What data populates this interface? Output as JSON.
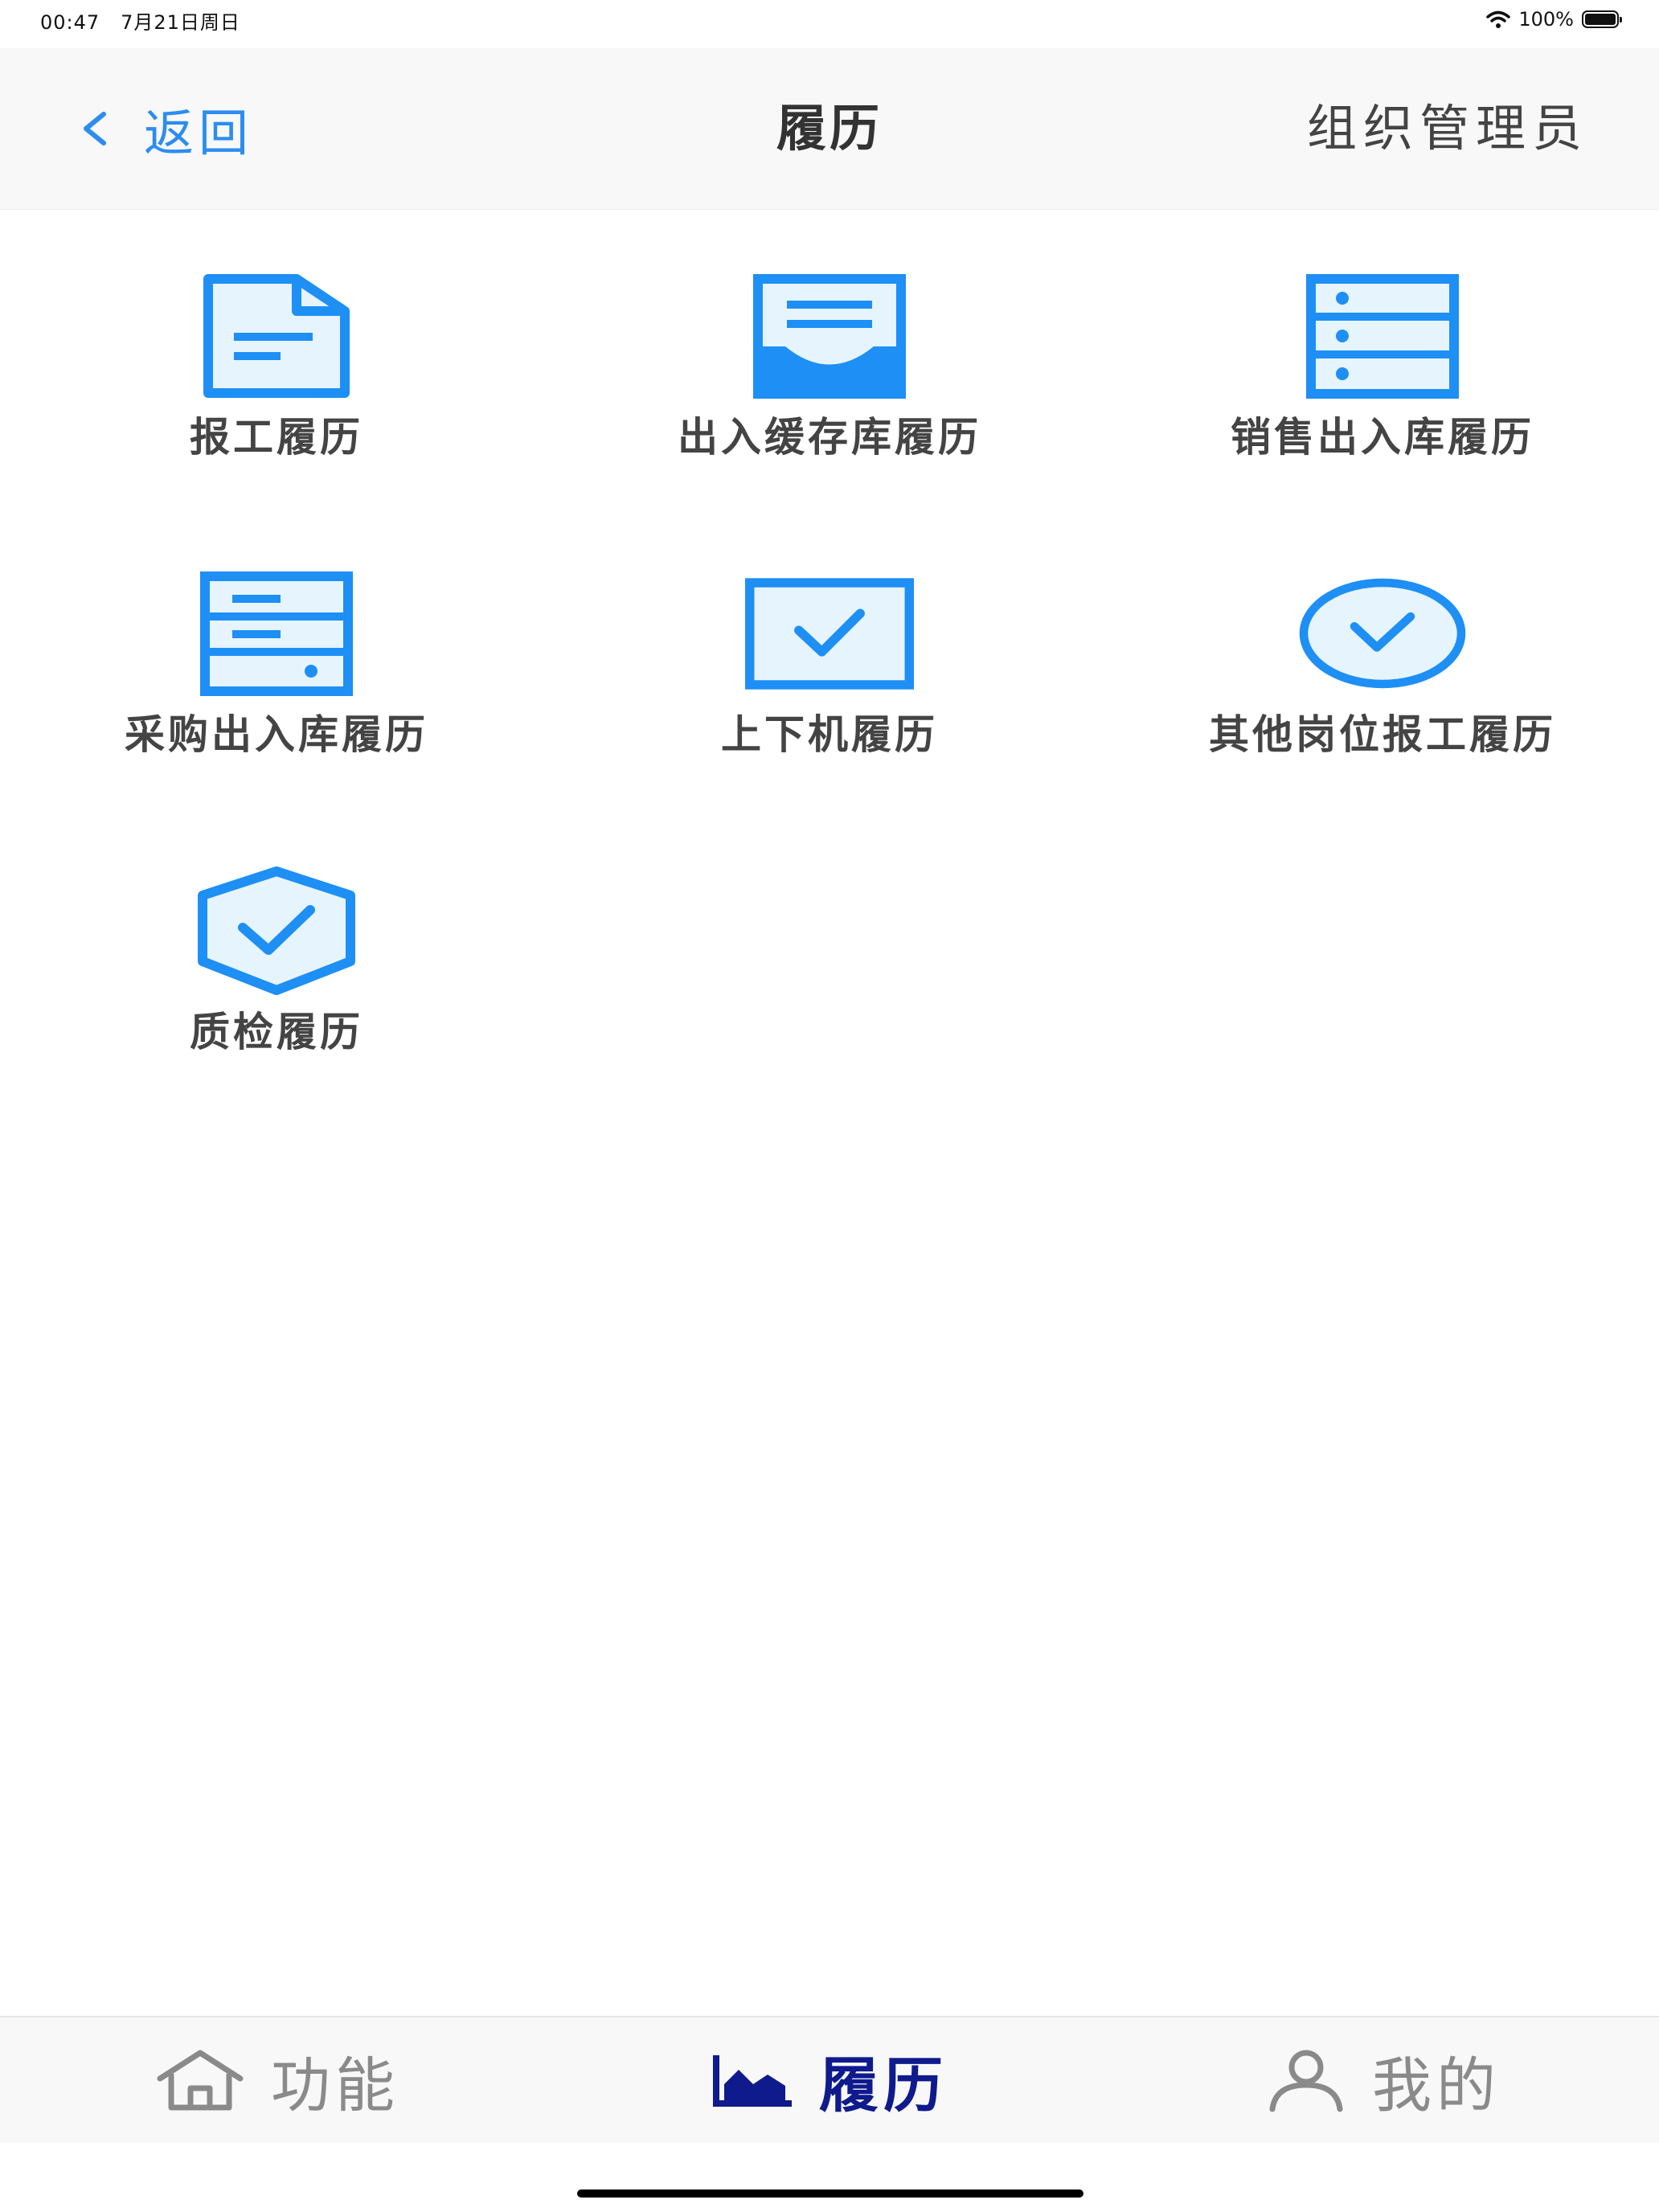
{
  "status_bar": {
    "time": "00:47",
    "date": "7月21日周日",
    "battery": "100%"
  },
  "nav": {
    "back_label": "返回",
    "title": "履历",
    "right_label": "组织管理员"
  },
  "grid": {
    "items": [
      {
        "label": "报工履历",
        "icon": "document-icon"
      },
      {
        "label": "出入缓存库履历",
        "icon": "inbox-tray-icon"
      },
      {
        "label": "销售出入库履历",
        "icon": "server-rack-icon"
      },
      {
        "label": "采购出入库履历",
        "icon": "server-icon"
      },
      {
        "label": "上下机履历",
        "icon": "checkbox-icon"
      },
      {
        "label": "其他岗位报工履历",
        "icon": "check-circle-icon"
      },
      {
        "label": "质检履历",
        "icon": "shield-check-icon"
      }
    ]
  },
  "tab_bar": {
    "tabs": [
      {
        "label": "功能",
        "icon": "home-icon",
        "active": false
      },
      {
        "label": "履历",
        "icon": "area-chart-icon",
        "active": true
      },
      {
        "label": "我的",
        "icon": "user-icon",
        "active": false
      }
    ]
  },
  "colors": {
    "accent": "#2d8cf0",
    "icon_blue": "#1e8ff5",
    "icon_fill": "#e6f4fd",
    "active_tab": "#0f1a8c",
    "inactive_tab": "#8a8a8a"
  }
}
